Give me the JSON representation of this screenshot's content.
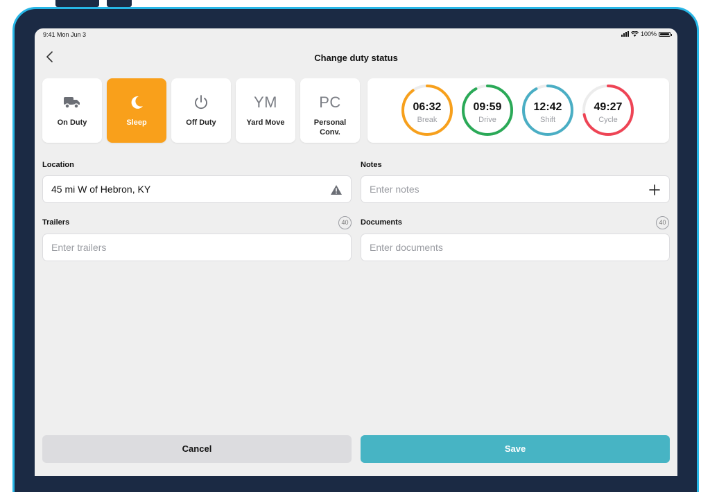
{
  "status_bar": {
    "time": "9:41 Mon Jun 3",
    "battery": "100%"
  },
  "header": {
    "title": "Change duty status"
  },
  "duty_statuses": [
    {
      "label": "On Duty",
      "icon": "truck-icon",
      "selected": false
    },
    {
      "label": "Sleep",
      "icon": "moon-icon",
      "selected": true
    },
    {
      "label": "Off Duty",
      "icon": "power-icon",
      "selected": false
    },
    {
      "label": "Yard Move",
      "icon_text": "YM",
      "selected": false
    },
    {
      "label": "Personal Conv.",
      "icon_text": "PC",
      "selected": false
    }
  ],
  "timers": [
    {
      "value": "06:32",
      "label": "Break",
      "color": "#f7a01c",
      "progress": 0.9
    },
    {
      "value": "09:59",
      "label": "Drive",
      "color": "#2aa957",
      "progress": 0.92
    },
    {
      "value": "12:42",
      "label": "Shift",
      "color": "#4aaec4",
      "progress": 0.92
    },
    {
      "value": "49:27",
      "label": "Cycle",
      "color": "#ee4455",
      "progress": 0.72
    }
  ],
  "location": {
    "label": "Location",
    "value": "45 mi W of Hebron, KY",
    "icon": "warning-icon"
  },
  "notes": {
    "label": "Notes",
    "placeholder": "Enter notes",
    "icon": "plus-icon"
  },
  "trailers": {
    "label": "Trailers",
    "placeholder": "Enter trailers",
    "count": "40"
  },
  "documents": {
    "label": "Documents",
    "placeholder": "Enter documents",
    "count": "40"
  },
  "actions": {
    "cancel": "Cancel",
    "save": "Save"
  },
  "colors": {
    "accent": "#f9a01b",
    "save": "#47b4c4",
    "bezel": "#1b2a44",
    "bezel_border": "#27b6e6"
  }
}
